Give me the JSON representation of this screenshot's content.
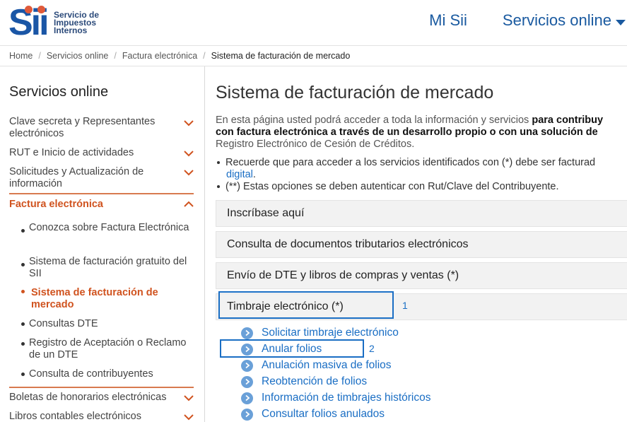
{
  "header": {
    "logo_main": "Sii",
    "logo_lines": [
      "Servicio de",
      "Impuestos",
      "Internos"
    ],
    "nav_mi_sii": "Mi Sii",
    "nav_servicios": "Servicios online"
  },
  "breadcrumb": [
    "Home",
    "Servicios online",
    "Factura electrónica",
    "Sistema de facturación de mercado"
  ],
  "sidebar": {
    "title": "Servicios online",
    "items": [
      {
        "label": "Clave secreta y Representantes electrónicos"
      },
      {
        "label": "RUT e Inicio de actividades"
      },
      {
        "label": "Solicitudes y Actualización de información"
      },
      {
        "label": "Factura electrónica"
      },
      {
        "label": "Boletas de honorarios electrónicas"
      },
      {
        "label": "Libros contables electrónicos"
      }
    ],
    "sub_items": [
      {
        "label": "Conozca sobre Factura Electrónica"
      },
      {
        "label": "Sistema de facturación gratuito del SII"
      },
      {
        "label": "Sistema de facturación de mercado"
      },
      {
        "label": "Consultas DTE"
      },
      {
        "label": "Registro de Aceptación o Reclamo de un DTE"
      },
      {
        "label": "Consulta de contribuyentes"
      }
    ]
  },
  "main": {
    "title": "Sistema de facturación de mercado",
    "intro_1a": "En esta página usted podrá acceder a toda la información y servicios ",
    "intro_1b": "para contribuy",
    "intro_2": "con factura electrónica a través de un desarrollo propio o con una solución de",
    "intro_3": "Registro Electrónico de Cesión de Créditos.",
    "note_1": "Recuerde que para acceder a los servicios identificados con (*) debe ser facturad",
    "note_1_link": "digital",
    "note_1_end": ".",
    "note_2": "(**) Estas opciones se deben autenticar con Rut/Clave del Contribuyente.",
    "accordions": [
      {
        "label": "Inscríbase aquí"
      },
      {
        "label": "Consulta de documentos tributarios electrónicos"
      },
      {
        "label": "Envío de DTE y libros de compras y ventas (*)"
      },
      {
        "label": "Timbraje electrónico (*)"
      }
    ],
    "timbraje_links": [
      {
        "label": "Solicitar timbraje electrónico"
      },
      {
        "label": "Anular folios"
      },
      {
        "label": "Anulación masiva de folios"
      },
      {
        "label": "Reobtención de folios"
      },
      {
        "label": "Información de timbrajes históricos"
      },
      {
        "label": "Consultar folios anulados"
      }
    ]
  },
  "annotations": {
    "box1_number": "1",
    "box2_number": "2"
  },
  "colors": {
    "brand_blue": "#1a56a6",
    "link_blue": "#1a6ec4",
    "accent_orange": "#d0531f",
    "logo_dot": "#e05a3a"
  }
}
